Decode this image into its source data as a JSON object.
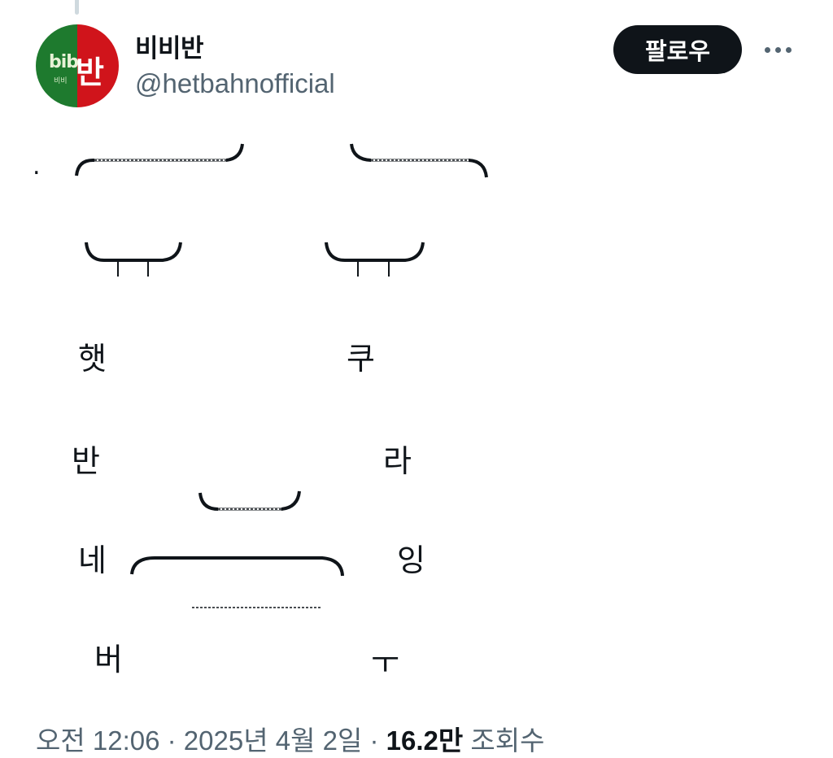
{
  "profile": {
    "display_name": "비비반",
    "handle": "@hetbahnofficial",
    "avatar_text_left": "bib",
    "avatar_text_right": "반",
    "avatar_text_small": "비비",
    "avatar_colors": {
      "left": "#1e7a2e",
      "right": "#d0141b"
    }
  },
  "actions": {
    "follow_label": "팔로우",
    "more_icon": "more-horizontal-icon"
  },
  "art": {
    "dot": ".",
    "left_column": [
      "햇",
      "반",
      "네",
      "버"
    ],
    "right_column": [
      "쿠",
      "라",
      "잉",
      "ㅜ"
    ]
  },
  "meta": {
    "timestamp": "오전 12:06 · 2025년 4월 2일 · ",
    "views_count": "16.2만",
    "views_label": " 조회수"
  }
}
